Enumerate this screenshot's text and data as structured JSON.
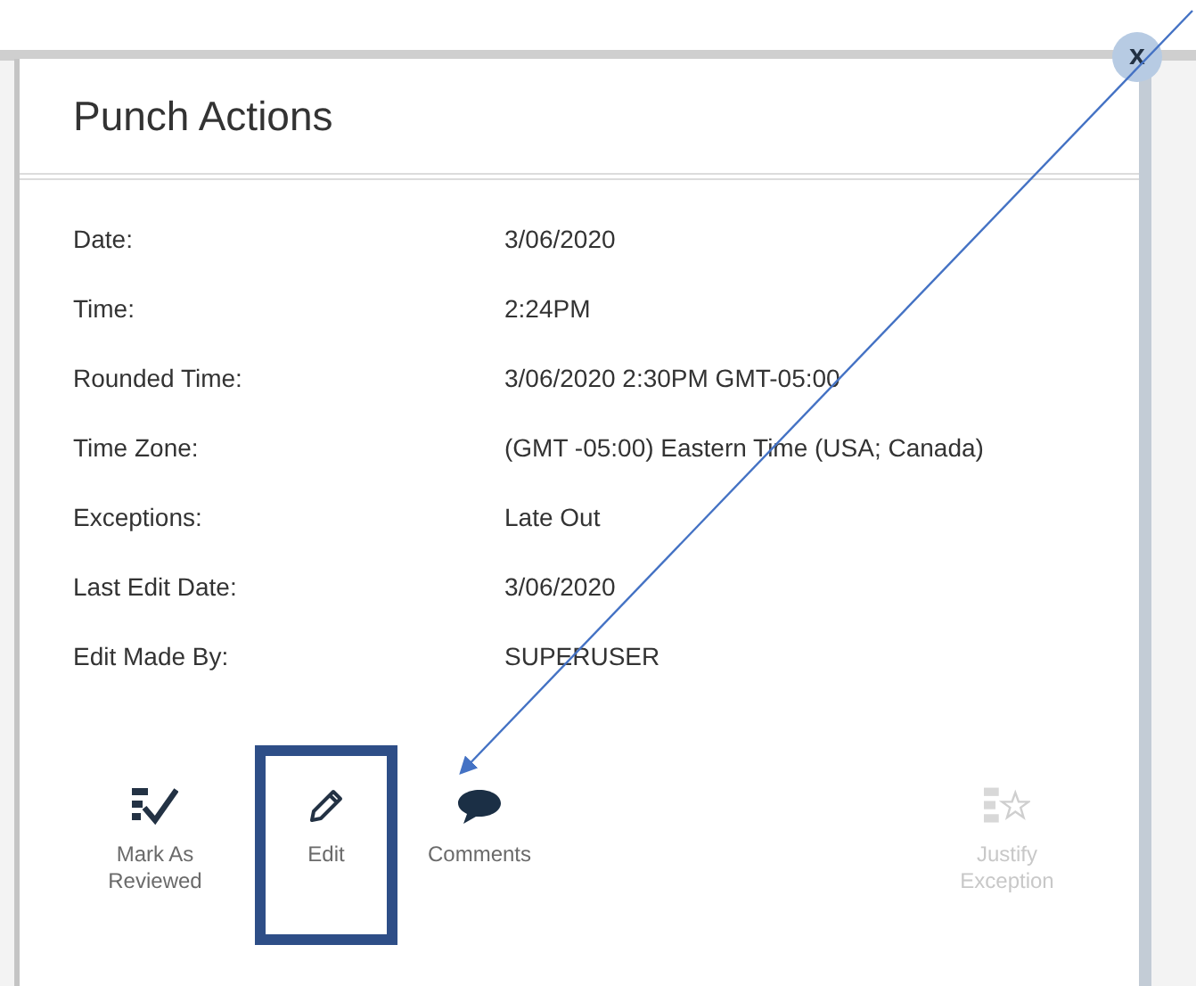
{
  "dialog": {
    "title": "Punch Actions",
    "close_label": "x"
  },
  "details": [
    {
      "label": "Date:",
      "value": "3/06/2020"
    },
    {
      "label": "Time:",
      "value": "2:24PM"
    },
    {
      "label": "Rounded Time:",
      "value": "3/06/2020 2:30PM GMT-05:00"
    },
    {
      "label": "Time Zone:",
      "value": "(GMT -05:00) Eastern Time (USA; Canada)"
    },
    {
      "label": "Exceptions:",
      "value": "Late Out"
    },
    {
      "label": "Last Edit Date:",
      "value": "3/06/2020"
    },
    {
      "label": "Edit Made By:",
      "value": "SUPERUSER"
    }
  ],
  "actions": [
    {
      "kind": "review",
      "label": "Mark As Reviewed",
      "disabled": false,
      "highlighted": false
    },
    {
      "kind": "edit",
      "label": "Edit",
      "disabled": false,
      "highlighted": true
    },
    {
      "kind": "comments",
      "label": "Comments",
      "disabled": false,
      "highlighted": false
    },
    {
      "kind": "justify",
      "label": "Justify Exception",
      "disabled": true,
      "highlighted": false
    }
  ]
}
